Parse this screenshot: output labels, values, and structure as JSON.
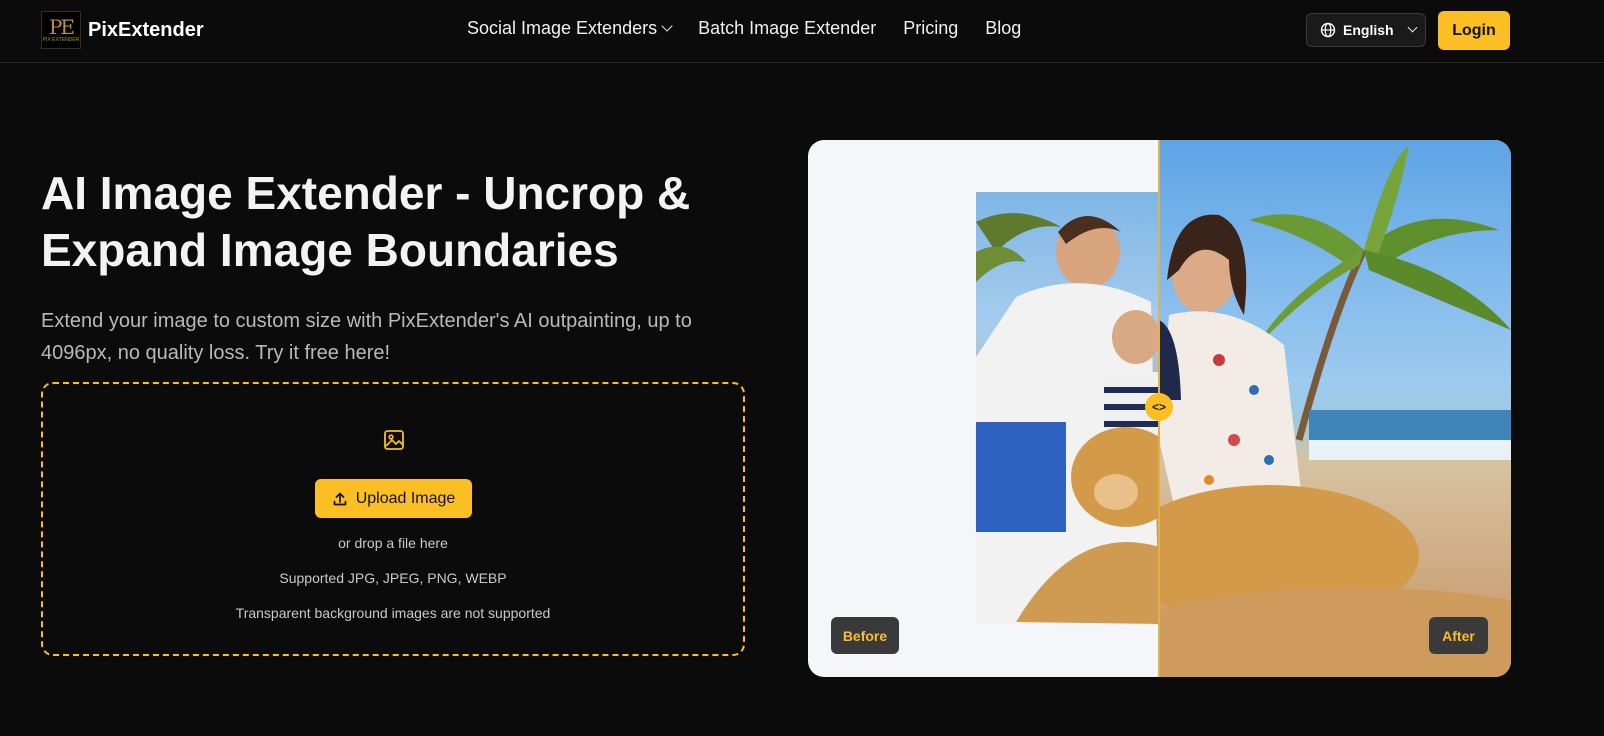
{
  "header": {
    "logo_mark": "PE",
    "logo_tagline": "PIX EXTENDER",
    "brand": "PixExtender",
    "nav": [
      {
        "label": "Social Image Extenders",
        "has_dropdown": true
      },
      {
        "label": "Batch Image Extender"
      },
      {
        "label": "Pricing"
      },
      {
        "label": "Blog"
      }
    ],
    "language": {
      "icon": "globe-icon",
      "value": "English"
    },
    "login_label": "Login"
  },
  "hero": {
    "title": "AI Image Extender - Uncrop & Expand Image Boundaries",
    "subtitle": "Extend your image to custom size with PixExtender's AI outpainting, up to 4096px, no quality loss. Try it free here!"
  },
  "upload": {
    "icon": "image-icon",
    "button_icon": "upload-icon",
    "button_label": "Upload Image",
    "drop_hint": "or drop a file here",
    "formats": "Supported JPG, JPEG, PNG, WEBP",
    "note": "Transparent background images are not supported"
  },
  "comparison": {
    "before_label": "Before",
    "after_label": "After",
    "handle_glyph": "<>"
  },
  "colors": {
    "accent": "#fbbf24",
    "background": "#0b0b0c",
    "text": "#f2f2f2",
    "muted_text": "#b9b9b9",
    "tag_background": "#3a3a3a"
  }
}
